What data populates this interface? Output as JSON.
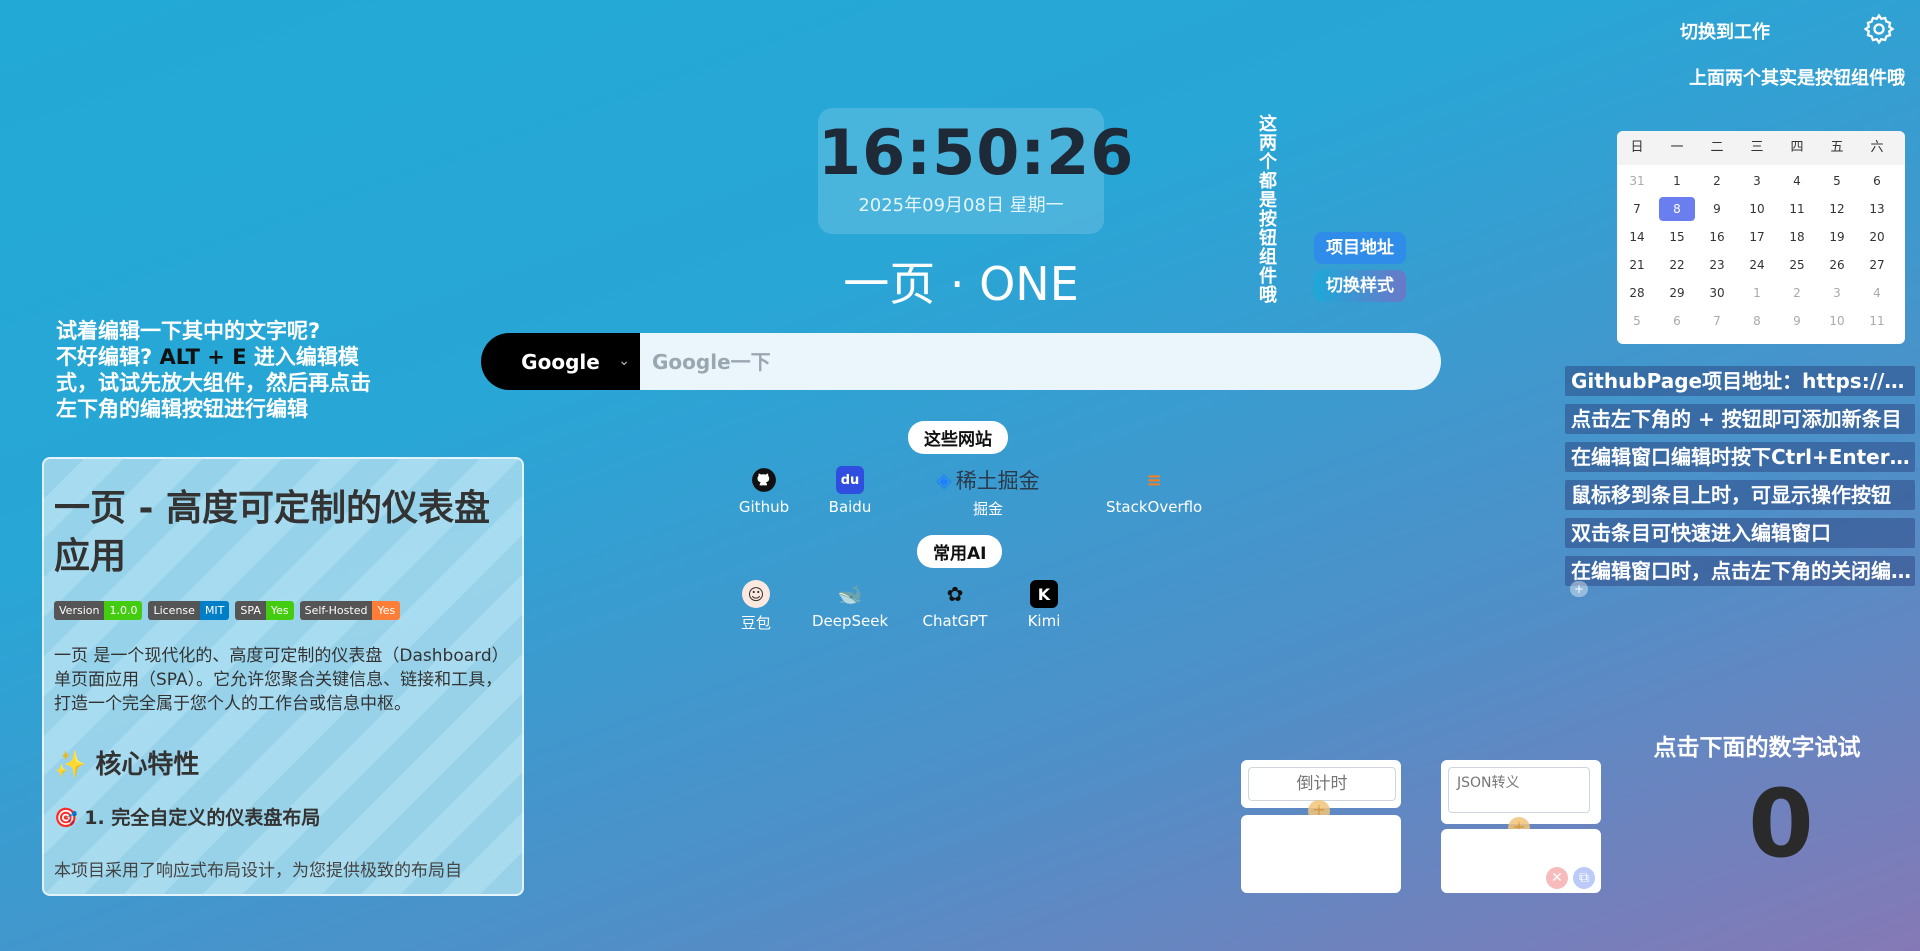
{
  "header": {
    "switch_label": "切换到工作",
    "note": "上面两个其实是按钮组件哦"
  },
  "clock": {
    "time": "16:50:26",
    "date": "2025年09月08日 星期一"
  },
  "brand": "一页 · ONE",
  "side_buttons": {
    "vertical_note": "这两个都是按钮组件哦",
    "project_label": "项目地址",
    "style_label": "切换样式"
  },
  "search": {
    "engine": "Google",
    "placeholder": "Google一下"
  },
  "link_groups": [
    {
      "title": "这些网站",
      "links": [
        {
          "label": "Github",
          "icon": "github-icon"
        },
        {
          "label": "Baidu",
          "icon": "baidu-icon"
        },
        {
          "label": "掘金",
          "logo_text": "稀土掘金",
          "icon": "juejin-icon"
        },
        {
          "label": "StackOverflow",
          "icon": "stackoverflow-icon"
        }
      ]
    },
    {
      "title": "常用AI",
      "links": [
        {
          "label": "豆包",
          "icon": "doubao-icon"
        },
        {
          "label": "DeepSeek",
          "icon": "deepseek-icon"
        },
        {
          "label": "ChatGPT",
          "icon": "chatgpt-icon"
        },
        {
          "label": "Kimi",
          "icon": "kimi-icon"
        }
      ]
    }
  ],
  "left_note": {
    "line1": "试着编辑一下其中的文字呢?",
    "line2a": "不好编辑? ",
    "shortcut": "ALT + E",
    "line2b": " 进入编辑模式，试试先放大组件，然后再点击左下角的编辑按钮进行编辑"
  },
  "readme": {
    "title": "一页 - 高度可定制的仪表盘应用",
    "badges": [
      {
        "key": "Version",
        "value": "1.0.0",
        "color": "#4c1"
      },
      {
        "key": "License",
        "value": "MIT",
        "color": "#007ec6"
      },
      {
        "key": "SPA",
        "value": "Yes",
        "color": "#4c1"
      },
      {
        "key": "Self-Hosted",
        "value": "Yes",
        "color": "#fe7d37"
      }
    ],
    "intro": "一页 是一个现代化的、高度可定制的仪表盘（Dashboard）单页面应用（SPA）。它允许您聚合关键信息、链接和工具，打造一个完全属于您个人的工作台或信息中枢。",
    "h2": "✨ 核心特性",
    "h3": "🎯 1. 完全自定义的仪表盘布局",
    "cut_text": "本项目采用了响应式布局设计，为您提供极致的布局自"
  },
  "calendar": {
    "weekdays": [
      "日",
      "一",
      "二",
      "三",
      "四",
      "五",
      "六"
    ],
    "weeks": [
      [
        "31",
        "1",
        "2",
        "3",
        "4",
        "5",
        "6"
      ],
      [
        "7",
        "8",
        "9",
        "10",
        "11",
        "12",
        "13"
      ],
      [
        "14",
        "15",
        "16",
        "17",
        "18",
        "19",
        "20"
      ],
      [
        "21",
        "22",
        "23",
        "24",
        "25",
        "26",
        "27"
      ],
      [
        "28",
        "29",
        "30",
        "1",
        "2",
        "3",
        "4"
      ],
      [
        "5",
        "6",
        "7",
        "8",
        "9",
        "10",
        "11"
      ]
    ],
    "today": "8"
  },
  "todos": [
    "GithubPage项目地址：https://github.com",
    "点击左下角的 + 按钮即可添加新条目",
    "在编辑窗口编辑时按下Ctrl+Enter即可保存",
    "鼠标移到条目上时，可显示操作按钮",
    "双击条目可快速进入编辑窗口",
    "在编辑窗口时，点击左下角的关闭编辑按钮"
  ],
  "widgets": {
    "countdown_placeholder": "倒计时",
    "json_placeholder": "JSON转义"
  },
  "counter": {
    "title": "点击下面的数字试试",
    "value": "0"
  }
}
